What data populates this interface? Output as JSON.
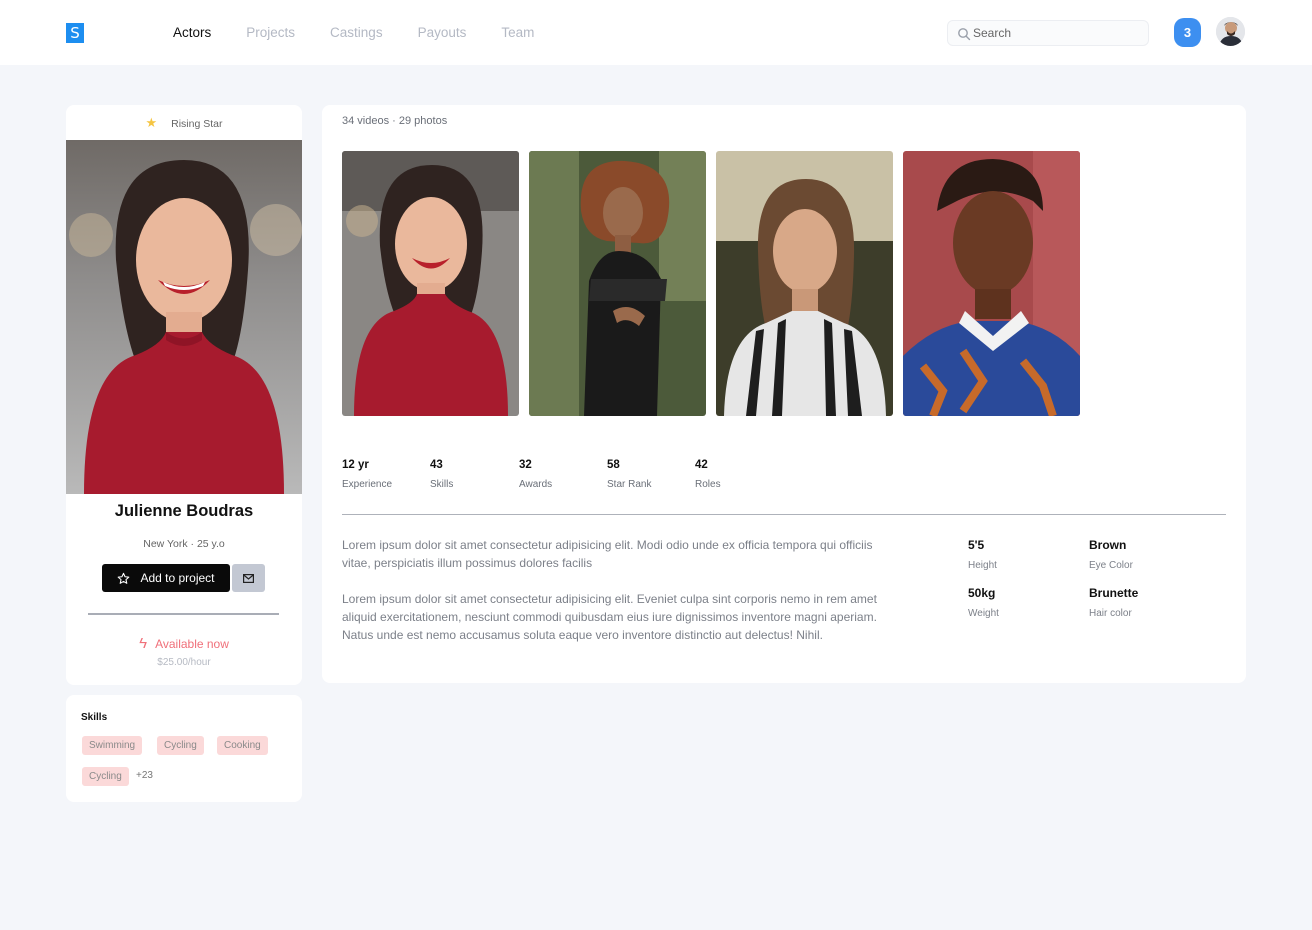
{
  "header": {
    "logo": "S",
    "nav": [
      "Actors",
      "Projects",
      "Castings",
      "Payouts",
      "Team"
    ],
    "active_nav": "Actors",
    "search_placeholder": "Search",
    "notification_count": "3"
  },
  "profile": {
    "badge": "Rising Star",
    "name": "Julienne Boudras",
    "location": "New York",
    "age": "25 y.o",
    "add_button": "Add to project",
    "availability": "Available now",
    "rate": "$25.00/hour"
  },
  "skills": {
    "title": "Skills",
    "chips": [
      "Swimming",
      "Cycling",
      "Cooking",
      "Cycling"
    ],
    "more": "+23"
  },
  "media": {
    "videos": "34 videos",
    "photos": "29 photos"
  },
  "stats": [
    {
      "value": "12 yr",
      "label": "Experience"
    },
    {
      "value": "43",
      "label": "Skills"
    },
    {
      "value": "32",
      "label": "Awards"
    },
    {
      "value": "58",
      "label": "Star Rank"
    },
    {
      "value": "42",
      "label": "Roles"
    }
  ],
  "bio": [
    "Lorem ipsum dolor sit amet consectetur adipisicing elit. Modi odio unde ex officia tempora qui officiis vitae, perspiciatis illum possimus dolores facilis",
    "Lorem ipsum dolor sit amet consectetur adipisicing elit. Eveniet culpa sint corporis nemo in rem amet aliquid exercitationem, nesciunt commodi quibusdam eius iure dignissimos inventore magni aperiam. Natus unde est nemo accusamus soluta eaque vero inventore distinctio aut delectus! Nihil."
  ],
  "attributes": [
    {
      "value": "5'5",
      "label": "Height"
    },
    {
      "value": "Brown",
      "label": "Eye Color"
    },
    {
      "value": "50kg",
      "label": "Weight"
    },
    {
      "value": "Brunette",
      "label": "Hair color"
    }
  ],
  "colors": {
    "accent": "#3d8ff0",
    "logo": "#1d8ef0",
    "available": "#f0707a",
    "chip_bg": "#fbd9d9",
    "star": "#f5c542"
  }
}
